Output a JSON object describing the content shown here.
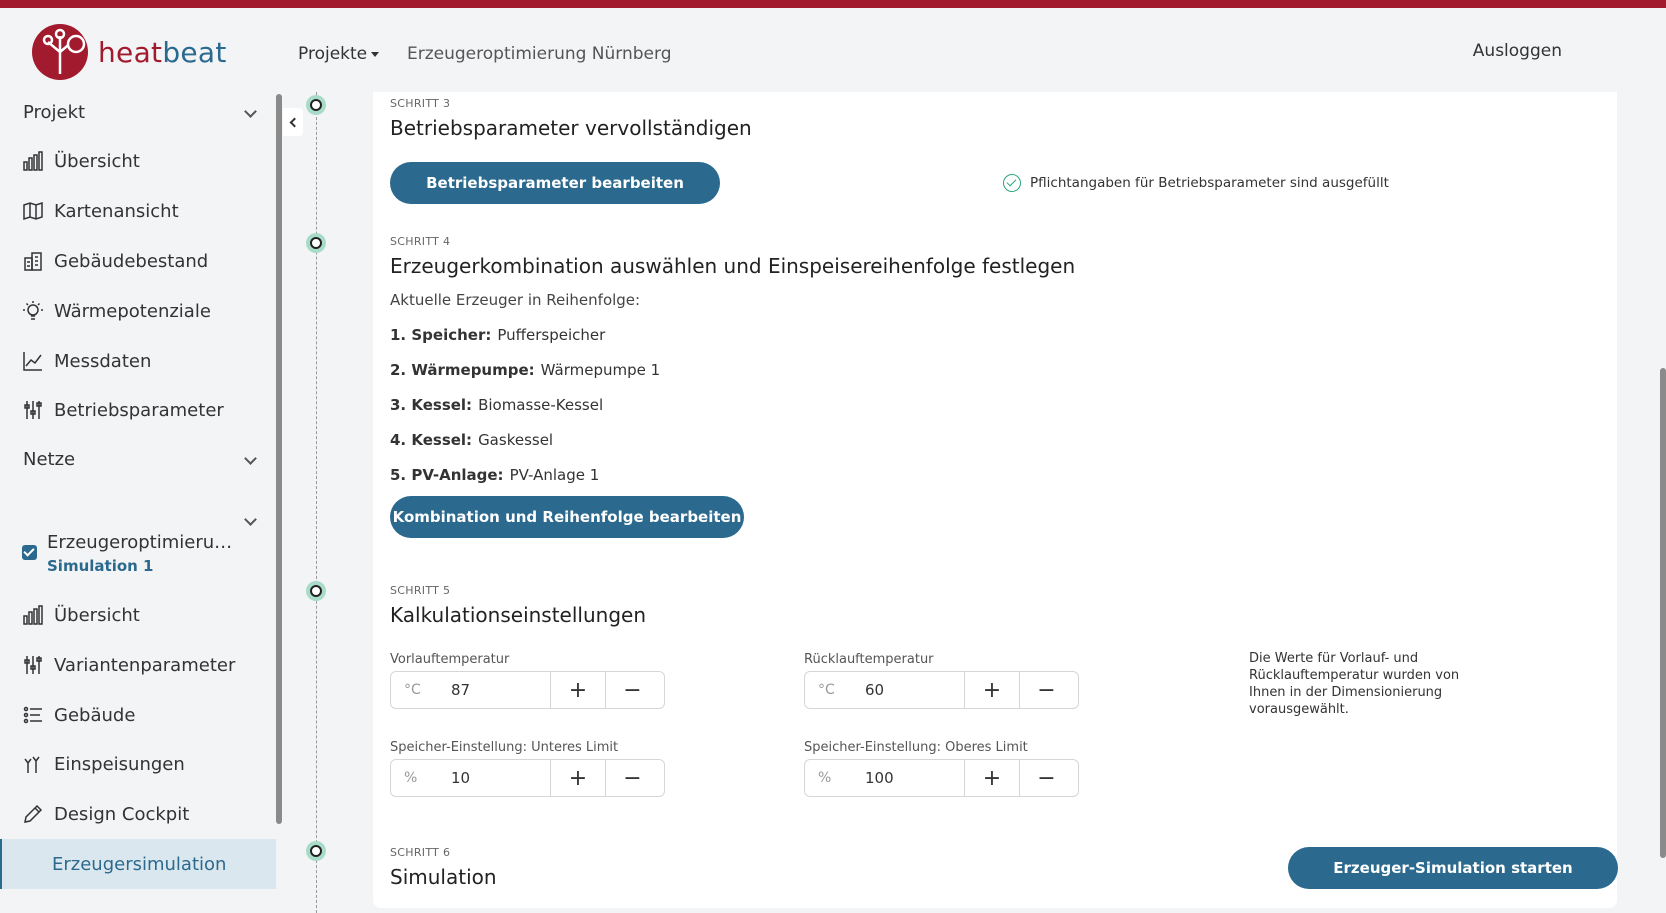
{
  "brand": {
    "heat": "heat",
    "beat": "beat"
  },
  "nav": {
    "projects_label": "Projekte",
    "crumb": "Erzeugeroptimierung Nürnberg",
    "logout_label": "Ausloggen"
  },
  "sidebar": {
    "project_header": "Projekt",
    "project_items": [
      {
        "label": "Übersicht",
        "icon": "bar-chart-icon"
      },
      {
        "label": "Kartenansicht",
        "icon": "map-icon"
      },
      {
        "label": "Gebäudebestand",
        "icon": "buildings-icon"
      },
      {
        "label": "Wärmepotenziale",
        "icon": "lightbulb-icon"
      },
      {
        "label": "Messdaten",
        "icon": "line-chart-icon"
      },
      {
        "label": "Betriebsparameter",
        "icon": "sliders-icon"
      }
    ],
    "nets_header": "Netze",
    "variant_title": "Erzeugeroptimierung Nürnberg",
    "variant_sub": "Simulation 1",
    "variant_items": [
      {
        "label": "Übersicht",
        "icon": "bar-chart-icon"
      },
      {
        "label": "Variantenparameter",
        "icon": "sliders-icon"
      },
      {
        "label": "Gebäude",
        "icon": "list-icon"
      },
      {
        "label": "Einspeisungen",
        "icon": "feed-in-icon"
      },
      {
        "label": "Design Cockpit",
        "icon": "pencil-icon"
      }
    ],
    "active_item": "Erzeugersimulation"
  },
  "step3": {
    "label": "SCHRITT 3",
    "title": "Betriebsparameter vervollständigen",
    "button": "Betriebsparameter bearbeiten",
    "status": "Pflichtangaben für Betriebsparameter sind ausgefüllt"
  },
  "step4": {
    "label": "SCHRITT 4",
    "title": "Erzeugerkombination auswählen und Einspeisereihenfolge festlegen",
    "intro": "Aktuelle Erzeuger in Reihenfolge:",
    "sequence": [
      {
        "key": "1. Speicher:",
        "value": "Pufferspeicher"
      },
      {
        "key": "2. Wärmepumpe:",
        "value": "Wärmepumpe 1"
      },
      {
        "key": "3. Kessel:",
        "value": "Biomasse-Kessel"
      },
      {
        "key": "4. Kessel:",
        "value": "Gaskessel"
      },
      {
        "key": "5. PV-Anlage:",
        "value": "PV-Anlage 1"
      }
    ],
    "button": "Kombination und Reihenfolge bearbeiten"
  },
  "step5": {
    "label": "SCHRITT 5",
    "title": "Kalkulationseinstellungen",
    "fields": [
      {
        "label": "Vorlauftemperatur",
        "unit": "°C",
        "value": "87"
      },
      {
        "label": "Rücklauftemperatur",
        "unit": "°C",
        "value": "60"
      },
      {
        "label": "Speicher-Einstellung: Unteres Limit",
        "unit": "%",
        "value": "10"
      },
      {
        "label": "Speicher-Einstellung: Oberes Limit",
        "unit": "%",
        "value": "100"
      }
    ],
    "plus": "+",
    "minus": "−",
    "note": "Die Werte für Vorlauf- und Rücklauftemperatur wurden von Ihnen in der Dimensionierung vorausgewählt."
  },
  "step6": {
    "label": "SCHRITT 6",
    "title": "Simulation",
    "button": "Erzeuger-Simulation starten"
  }
}
